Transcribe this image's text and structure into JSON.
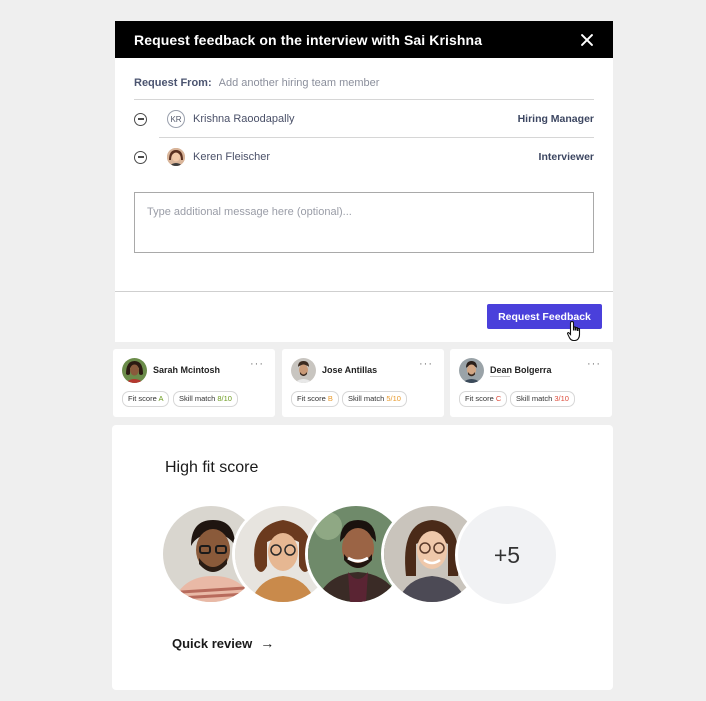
{
  "modal": {
    "title": "Request feedback on the interview with Sai Krishna",
    "request_from_label": "Request From:",
    "request_from_placeholder": "Add another hiring team member",
    "members": [
      {
        "initials": "KR",
        "name": "Krishna Raoodapally",
        "role": "Hiring Manager"
      },
      {
        "initials": "",
        "name": "Keren Fleischer",
        "role": "Interviewer"
      }
    ],
    "message_placeholder": "Type additional message here (optional)...",
    "request_button_label": "Request Feedback"
  },
  "candidates": [
    {
      "name": "Sarah Mcintosh",
      "fit_label": "Fit score",
      "fit_value": "A",
      "skill_label": "Skill match",
      "skill_value": "8/10",
      "color": "#6c9b1f"
    },
    {
      "name": "Jose Antillas",
      "fit_label": "Fit score",
      "fit_value": "B",
      "skill_label": "Skill match",
      "skill_value": "5/10",
      "color": "#e89a2c"
    },
    {
      "name": "Dean Bolgerra",
      "fit_label": "Fit score",
      "fit_value": "C",
      "skill_label": "Skill match",
      "skill_value": "3/10",
      "color": "#dd4b3a"
    }
  ],
  "more_menu": "···",
  "fit_panel": {
    "title": "High fit score",
    "more_count": "+5",
    "quick_review_label": "Quick review",
    "arrow": "→"
  },
  "colors": {
    "accent": "#4a40db",
    "header_bg": "#000000"
  }
}
